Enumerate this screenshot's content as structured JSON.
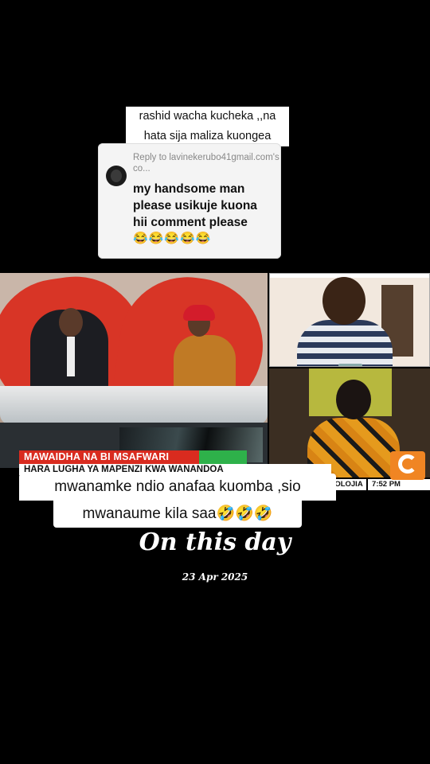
{
  "top_caption": {
    "line1": "rashid wacha kucheka ,,na",
    "line2": "hata sija maliza kuongea"
  },
  "reply_card": {
    "reply_to": "Reply to lavinekerubo41gmail.com's co...",
    "comment_line1": "my handsome man",
    "comment_line2": "please usikuje kuona",
    "comment_line3": "hii comment please",
    "emojis": "😂😂😂😂😂"
  },
  "news_ticker": {
    "headline": "MAWAIDHA NA BI MSAFWARI",
    "subline": "HARA LUGHA YA MAPENZI KWA WANANDOA",
    "segment": "OLOJIA",
    "time": "7:52 PM"
  },
  "bottom_caption": {
    "line1": "mwanamke ndio anafaa kuomba ,sio",
    "line2": "mwanaume kila saa🤣🤣🤣"
  },
  "memory": {
    "title": "On this day",
    "date": "23 Apr 2025"
  },
  "icons": [
    "avatar",
    "channel-logo-icon"
  ],
  "colors": {
    "background": "#000000",
    "ticker_red": "#d92b1f",
    "logo_orange": "#f08523"
  }
}
